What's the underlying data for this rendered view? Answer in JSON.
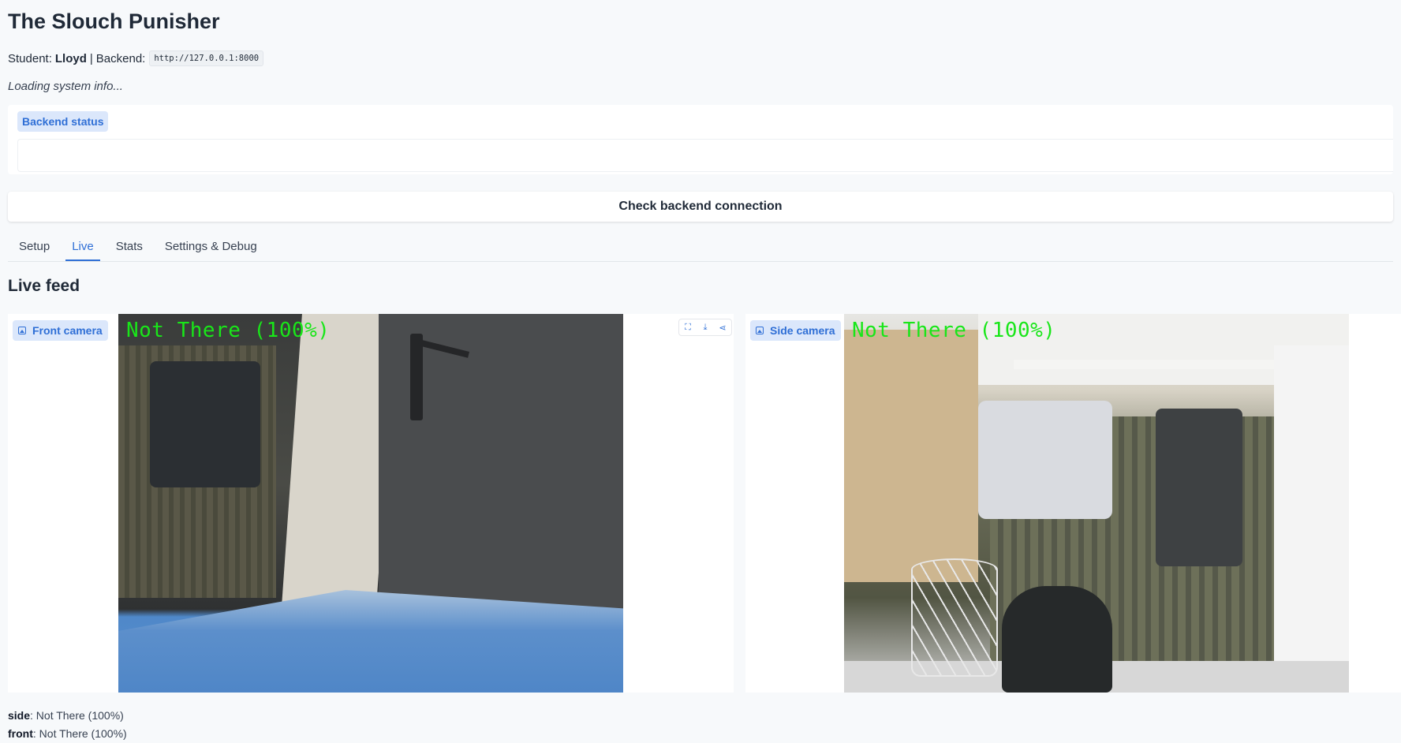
{
  "app": {
    "title": "The Slouch Punisher",
    "student_label": "Student:",
    "student_name": "Lloyd",
    "separator": "|",
    "backend_label": "Backend:",
    "backend_url": "http://127.0.0.1:8000",
    "loading_text": "Loading system info..."
  },
  "status": {
    "badge_label": "Backend status",
    "value": ""
  },
  "actions": {
    "check_backend": "Check backend connection"
  },
  "tabs": [
    {
      "label": "Setup",
      "active": false
    },
    {
      "label": "Live",
      "active": true
    },
    {
      "label": "Stats",
      "active": false
    },
    {
      "label": "Settings & Debug",
      "active": false
    }
  ],
  "live": {
    "heading": "Live feed",
    "front": {
      "label": "Front camera",
      "overlay": "Not There (100%)"
    },
    "side": {
      "label": "Side camera",
      "overlay": "Not There (100%)"
    },
    "toolbar_icons": [
      "fullscreen-icon",
      "download-icon",
      "share-icon"
    ]
  },
  "results": [
    {
      "key": "side",
      "value": ": Not There (100%)"
    },
    {
      "key": "front",
      "value": ": Not There (100%)"
    }
  ],
  "colors": {
    "accent": "#2f6fd6",
    "badge_bg": "#dbe7fb",
    "overlay_green": "#19e619"
  }
}
